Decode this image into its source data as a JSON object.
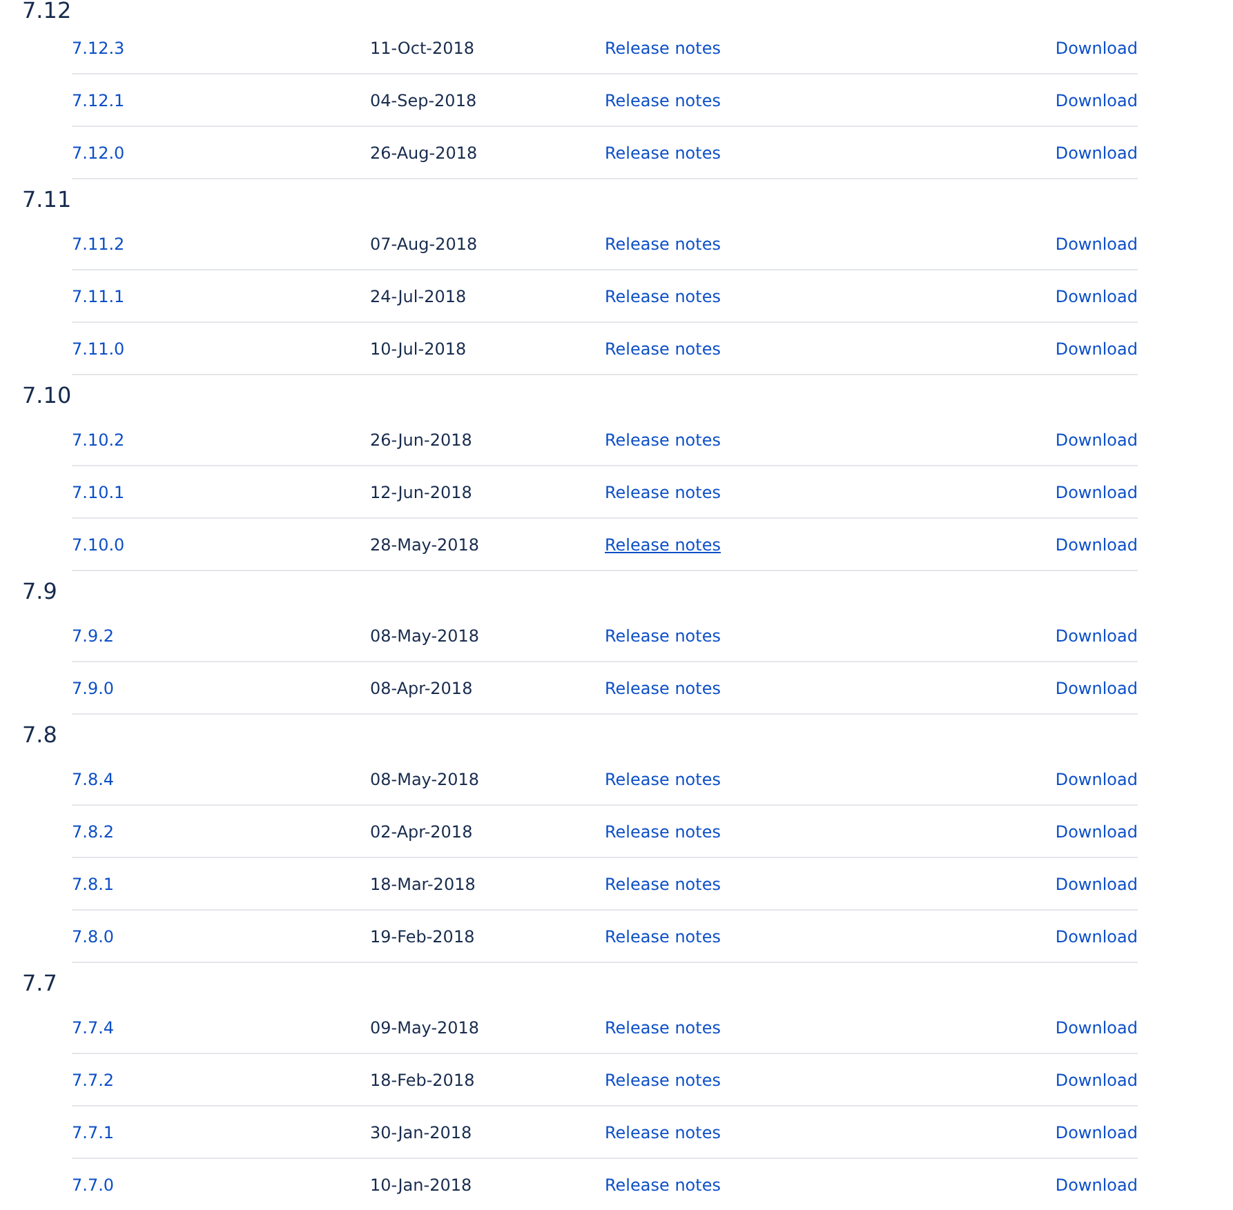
{
  "groups": [
    {
      "title": "7.12",
      "releases": [
        {
          "version": "7.12.3",
          "date": "11-Oct-2018",
          "notes": "Release notes",
          "notes_hovered": false,
          "download": "Download"
        },
        {
          "version": "7.12.1",
          "date": "04-Sep-2018",
          "notes": "Release notes",
          "notes_hovered": false,
          "download": "Download"
        },
        {
          "version": "7.12.0",
          "date": "26-Aug-2018",
          "notes": "Release notes",
          "notes_hovered": false,
          "download": "Download"
        }
      ]
    },
    {
      "title": "7.11",
      "releases": [
        {
          "version": "7.11.2",
          "date": "07-Aug-2018",
          "notes": "Release notes",
          "notes_hovered": false,
          "download": "Download"
        },
        {
          "version": "7.11.1",
          "date": "24-Jul-2018",
          "notes": "Release notes",
          "notes_hovered": false,
          "download": "Download"
        },
        {
          "version": "7.11.0",
          "date": "10-Jul-2018",
          "notes": "Release notes",
          "notes_hovered": false,
          "download": "Download"
        }
      ]
    },
    {
      "title": "7.10",
      "releases": [
        {
          "version": "7.10.2",
          "date": "26-Jun-2018",
          "notes": "Release notes",
          "notes_hovered": false,
          "download": "Download"
        },
        {
          "version": "7.10.1",
          "date": "12-Jun-2018",
          "notes": "Release notes",
          "notes_hovered": false,
          "download": "Download"
        },
        {
          "version": "7.10.0",
          "date": "28-May-2018",
          "notes": "Release notes",
          "notes_hovered": true,
          "download": "Download"
        }
      ]
    },
    {
      "title": "7.9",
      "releases": [
        {
          "version": "7.9.2",
          "date": "08-May-2018",
          "notes": "Release notes",
          "notes_hovered": false,
          "download": "Download"
        },
        {
          "version": "7.9.0",
          "date": "08-Apr-2018",
          "notes": "Release notes",
          "notes_hovered": false,
          "download": "Download"
        }
      ]
    },
    {
      "title": "7.8",
      "releases": [
        {
          "version": "7.8.4",
          "date": "08-May-2018",
          "notes": "Release notes",
          "notes_hovered": false,
          "download": "Download"
        },
        {
          "version": "7.8.2",
          "date": "02-Apr-2018",
          "notes": "Release notes",
          "notes_hovered": false,
          "download": "Download"
        },
        {
          "version": "7.8.1",
          "date": "18-Mar-2018",
          "notes": "Release notes",
          "notes_hovered": false,
          "download": "Download"
        },
        {
          "version": "7.8.0",
          "date": "19-Feb-2018",
          "notes": "Release notes",
          "notes_hovered": false,
          "download": "Download"
        }
      ]
    },
    {
      "title": "7.7",
      "releases": [
        {
          "version": "7.7.4",
          "date": "09-May-2018",
          "notes": "Release notes",
          "notes_hovered": false,
          "download": "Download"
        },
        {
          "version": "7.7.2",
          "date": "18-Feb-2018",
          "notes": "Release notes",
          "notes_hovered": false,
          "download": "Download"
        },
        {
          "version": "7.7.1",
          "date": "30-Jan-2018",
          "notes": "Release notes",
          "notes_hovered": false,
          "download": "Download"
        },
        {
          "version": "7.7.0",
          "date": "10-Jan-2018",
          "notes": "Release notes",
          "notes_hovered": false,
          "download": "Download"
        }
      ]
    }
  ]
}
